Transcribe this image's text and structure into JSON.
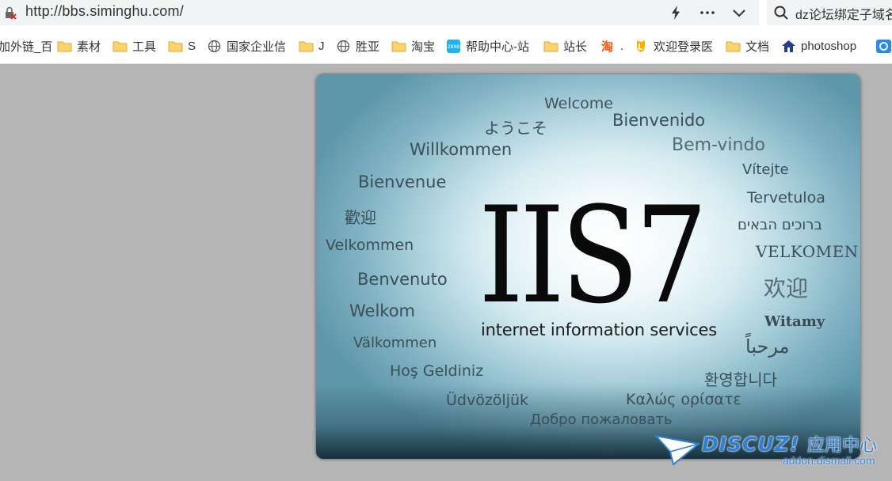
{
  "address_bar": {
    "url": "http://bbs.siminghu.com/",
    "site_icon": "insecure-site-icon",
    "buttons": [
      "bolt-icon",
      "more-icon",
      "chevron-down-icon"
    ]
  },
  "search": {
    "text": "dz论坛绑定子域名"
  },
  "bookmarks": [
    {
      "label": "加外链_百",
      "icon": "none"
    },
    {
      "label": "素材",
      "icon": "folder-icon"
    },
    {
      "label": "工具",
      "icon": "folder-icon"
    },
    {
      "label": "S",
      "icon": "folder-icon"
    },
    {
      "label": "国家企业信",
      "icon": "globe-icon"
    },
    {
      "label": "J",
      "icon": "folder-icon"
    },
    {
      "label": "胜亚",
      "icon": "globe-icon"
    },
    {
      "label": "淘宝",
      "icon": "folder-icon"
    },
    {
      "label": "帮助中心-站",
      "icon": "app-icon"
    },
    {
      "label": "站长",
      "icon": "folder-icon"
    },
    {
      "label": ".",
      "icon": "taobao-icon"
    },
    {
      "label": "欢迎登录医",
      "icon": "shield-icon"
    },
    {
      "label": "文档",
      "icon": "folder-icon"
    },
    {
      "label": "photoshop",
      "icon": "home-icon"
    }
  ],
  "iis_page": {
    "logo": "IIS7",
    "subtitle": "internet information services",
    "greetings": {
      "welcome": "Welcome",
      "japanese": "ようこそ",
      "spanish": "Bienvenido",
      "german": "Willkommen",
      "portuguese": "Bem-vindo",
      "french": "Bienvenue",
      "czech": "Vítejte",
      "finnish": "Tervetuloa",
      "chinese_traditional": "歡迎",
      "hebrew": "ברוכים הבאים",
      "danish": "Velkommen",
      "norwegian": "VELKOMEN",
      "italian": "Benvenuto",
      "chinese_simplified": "欢迎",
      "dutch": "Welkom",
      "polish": "Witamy",
      "swedish": "Välkommen",
      "arabic": "مرحباً",
      "turkish": "Hoş Geldiniz",
      "korean": "환영합니다",
      "hungarian": "Üdvözöljük",
      "greek": "Καλώς ορίσατε",
      "russian": "Добро пожаловать"
    }
  },
  "watermark": {
    "brand": "DISCUZ!",
    "brand_cn": "应用中心",
    "domain": "addon.dismall.com"
  }
}
